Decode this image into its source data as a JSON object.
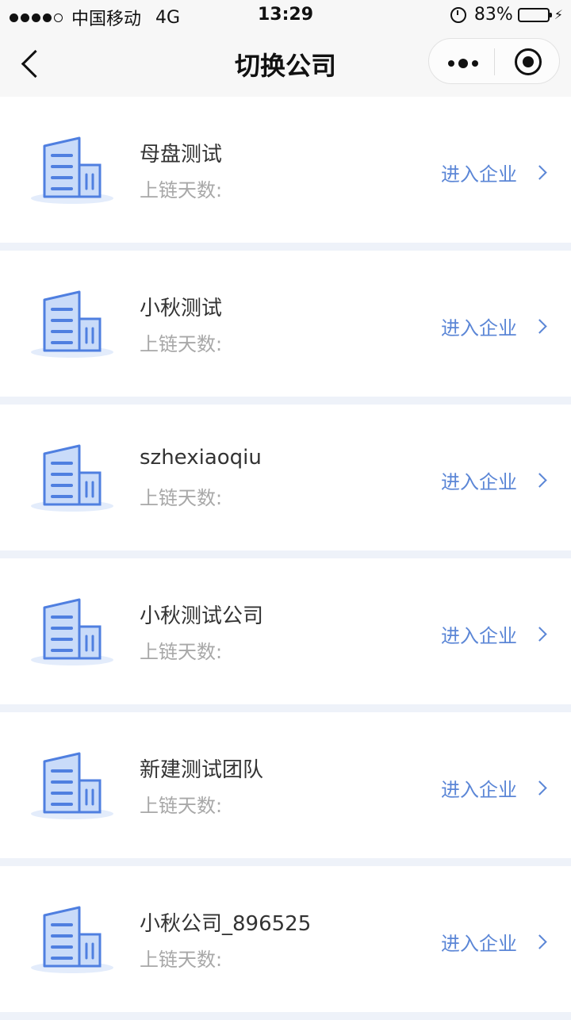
{
  "status_bar": {
    "carrier": "中国移动",
    "network": "4G",
    "time": "13:29",
    "battery": "83%",
    "battery_level": 0.83,
    "icons": [
      "signal-icon",
      "alarm-icon",
      "battery-icon",
      "charging-icon"
    ]
  },
  "nav": {
    "title": "切换公司",
    "icons": [
      "back-icon",
      "more-icon",
      "close-icon"
    ]
  },
  "colors": {
    "accent": "#5b86d6",
    "building_light": "#c9dbf9",
    "building_dark": "#4f7fe0",
    "battery_fill": "#4cd964",
    "page_bg": "#eef2f9"
  },
  "companies": [
    {
      "name": "母盘测试",
      "days_label": "上链天数:",
      "enter_label": "进入企业"
    },
    {
      "name": "小秋测试",
      "days_label": "上链天数:",
      "enter_label": "进入企业"
    },
    {
      "name": "szhexiaoqiu",
      "days_label": "上链天数:",
      "enter_label": "进入企业"
    },
    {
      "name": "小秋测试公司",
      "days_label": "上链天数:",
      "enter_label": "进入企业"
    },
    {
      "name": "新建测试团队",
      "days_label": "上链天数:",
      "enter_label": "进入企业"
    },
    {
      "name": "小秋公司_896525",
      "days_label": "上链天数:",
      "enter_label": "进入企业"
    }
  ]
}
